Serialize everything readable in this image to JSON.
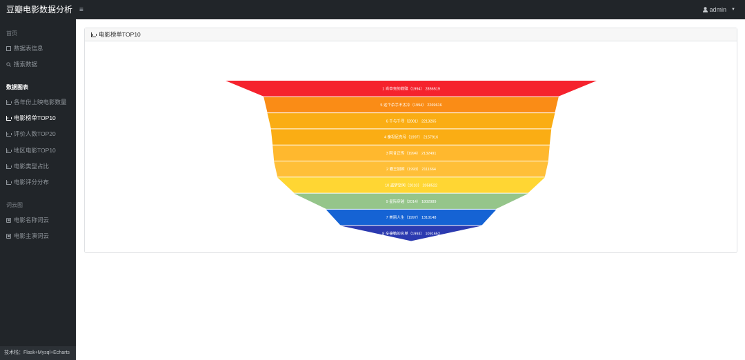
{
  "app": {
    "title": "豆瓣电影数据分析",
    "menu_toggle": "≡",
    "user": "admin"
  },
  "sidebar": {
    "sections": [
      {
        "heading": "首页",
        "items": [
          {
            "label": "数据表信息",
            "icon": "table-icon"
          },
          {
            "label": "搜索数据",
            "icon": "search-icon"
          }
        ]
      },
      {
        "heading": "数据图表",
        "items": [
          {
            "label": "各年份上映电影数量",
            "icon": "chart-icon"
          },
          {
            "label": "电影榜单TOP10",
            "icon": "chart-icon",
            "active": true
          },
          {
            "label": "评价人数TOP20",
            "icon": "chart-icon"
          },
          {
            "label": "地区电影TOP10",
            "icon": "chart-icon"
          },
          {
            "label": "电影类型占比",
            "icon": "chart-icon"
          },
          {
            "label": "电影评分分布",
            "icon": "chart-icon"
          }
        ]
      },
      {
        "heading": "词云图",
        "items": [
          {
            "label": "电影名称词云",
            "icon": "cloud-icon"
          },
          {
            "label": "电影主演词云",
            "icon": "cloud-icon"
          }
        ]
      }
    ],
    "footer": "技术栈：Flask+Mysql+Echarts"
  },
  "card": {
    "title": "电影榜单TOP10"
  },
  "chart_data": {
    "type": "funnel",
    "title": "",
    "sort": "descending",
    "label_position": "inside",
    "series": [
      {
        "rank": "1",
        "name": "肖申克的救赎",
        "year": "1994",
        "value": 2856519,
        "color": "#f5222d"
      },
      {
        "rank": "5",
        "name": "这个杀手不太冷",
        "year": "1994",
        "value": 2269616,
        "color": "#fa8c16"
      },
      {
        "rank": "6",
        "name": "千与千寻",
        "year": "2001",
        "value": 2213265,
        "color": "#faad14"
      },
      {
        "rank": "4",
        "name": "泰坦尼克号",
        "year": "1997",
        "value": 2157916,
        "color": "#faad14"
      },
      {
        "rank": "3",
        "name": "阿甘正传",
        "year": "1994",
        "value": 2132491,
        "color": "#ffb82e"
      },
      {
        "rank": "2",
        "name": "霸王别姬",
        "year": "1993",
        "value": 2111664,
        "color": "#ffbf38"
      },
      {
        "rank": "10",
        "name": "盗梦空间",
        "year": "2010",
        "value": 2058522,
        "color": "#ffd633"
      },
      {
        "rank": "9",
        "name": "星际穿越",
        "year": "2014",
        "value": 1802989,
        "color": "#95c58a"
      },
      {
        "rank": "7",
        "name": "美丽人生",
        "year": "1997",
        "value": 1310148,
        "color": "#1563d4"
      },
      {
        "rank": "8",
        "name": "辛德勒的名单",
        "year": "1993",
        "value": 1091652,
        "color": "#2b3ab0"
      }
    ]
  }
}
